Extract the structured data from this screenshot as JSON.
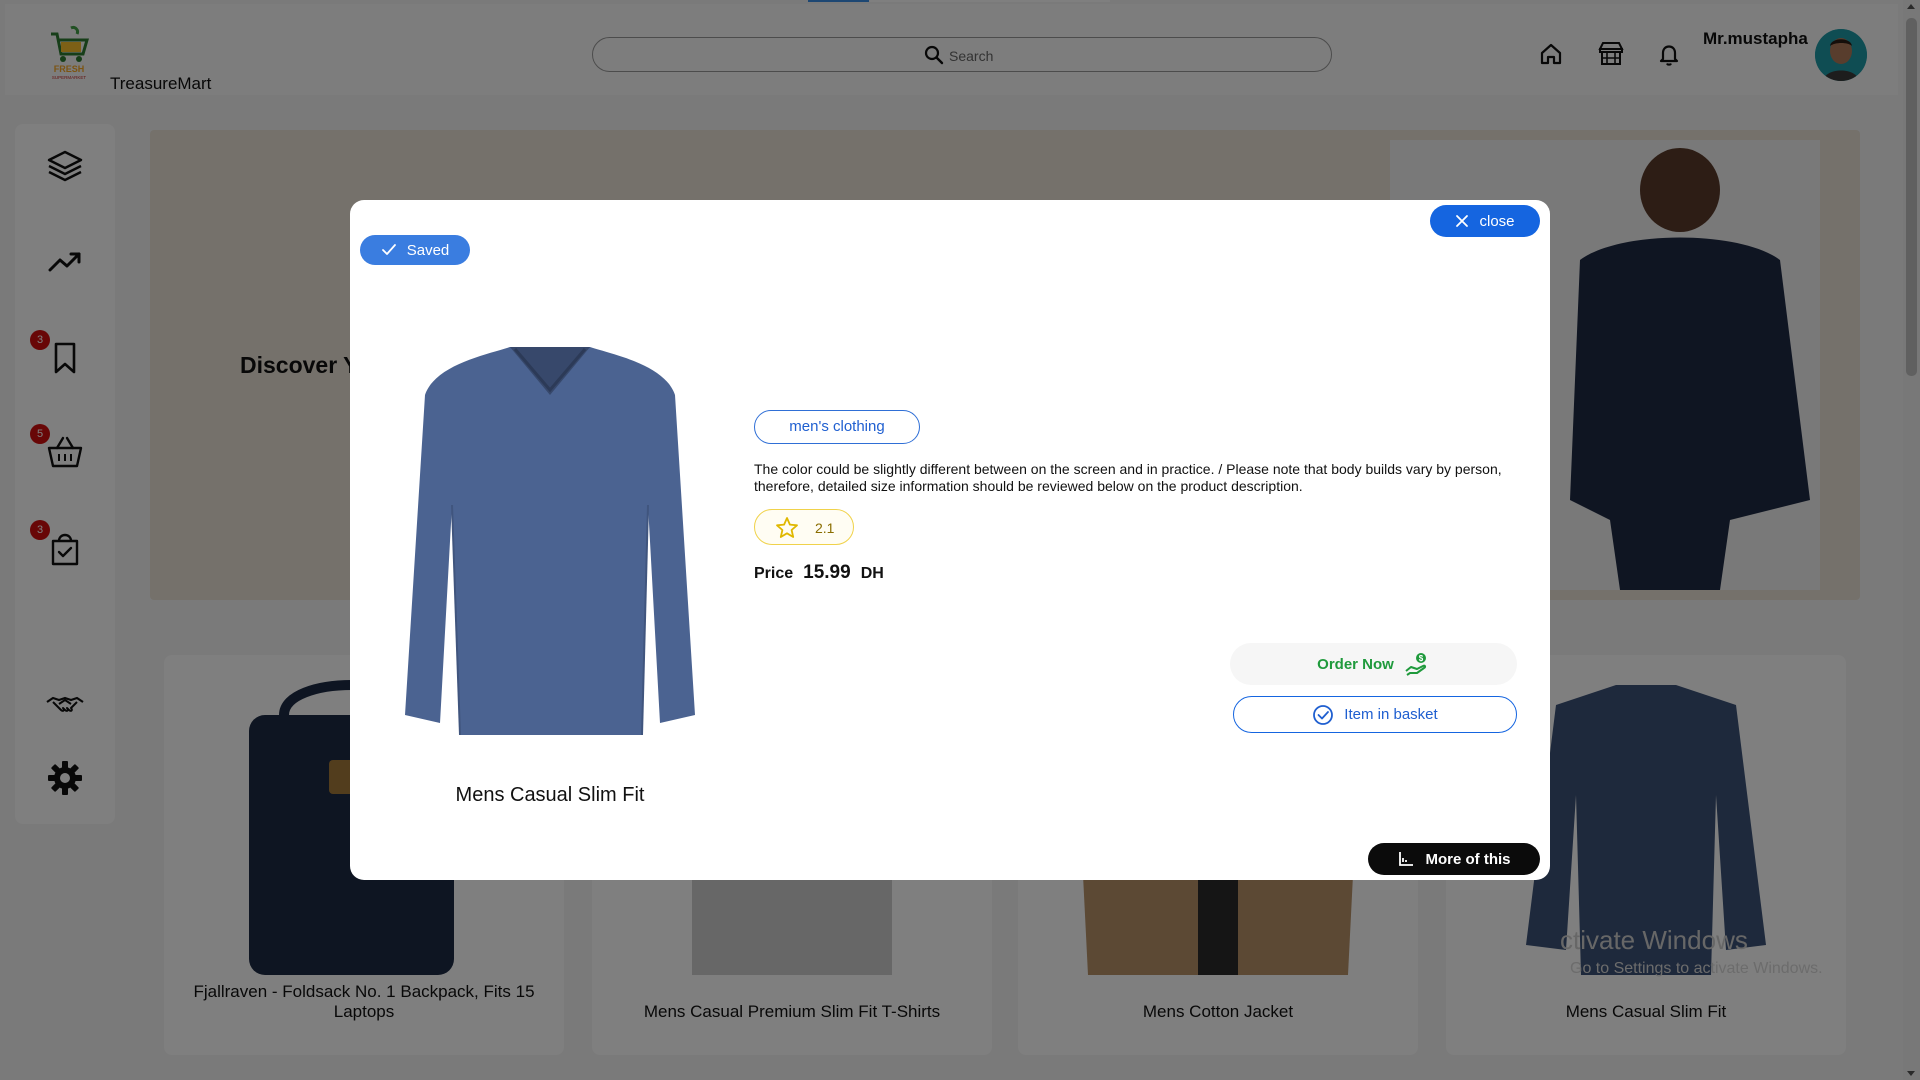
{
  "app": {
    "brand": "TreasureMart",
    "logo_text": "FRESH SUPERMARKET"
  },
  "header": {
    "search": {
      "placeholder": "Search"
    },
    "icons": [
      "home-icon",
      "store-icon",
      "bell-icon"
    ],
    "username": "Mr.mustapha"
  },
  "sidebar": {
    "items": [
      {
        "icon": "layers-icon",
        "badge": ""
      },
      {
        "icon": "trending-icon",
        "badge": ""
      },
      {
        "icon": "bookmark-icon",
        "badge": "3"
      },
      {
        "icon": "basket-icon",
        "badge": "5"
      },
      {
        "icon": "shopping-bag-icon",
        "badge": "3"
      },
      {
        "icon": "handshake-icon",
        "badge": ""
      },
      {
        "icon": "gear-icon",
        "badge": ""
      }
    ]
  },
  "hero": {
    "text": "Discover Yo"
  },
  "cards": [
    {
      "title": "Fjallraven - Foldsack No. 1 Backpack, Fits 15 Laptops"
    },
    {
      "title": "Mens Casual Premium Slim Fit T-Shirts"
    },
    {
      "title": "Mens Cotton Jacket"
    },
    {
      "title": "Mens Casual Slim Fit"
    }
  ],
  "watermark": {
    "line1": "ctivate Windows",
    "line2": "Go to Settings to activate Windows."
  },
  "modal": {
    "saved_label": "Saved",
    "close_label": "close",
    "product_name": "Mens Casual Slim Fit",
    "category": "men's clothing",
    "description": "The color could be slightly different between on the screen and in practice. / Please note that body builds vary by person, therefore, detailed size information should be reviewed below on the product description.",
    "rating": "2.1",
    "price_label": "Price",
    "price_value": "15.99",
    "currency": "DH",
    "order_label": "Order Now",
    "basket_label": "Item in basket",
    "more_label": "More of this"
  },
  "colors": {
    "primary_blue": "#1565e0",
    "saved_blue": "#3a7de0",
    "order_green": "#1f9a3c",
    "badge_red": "#d10f0f",
    "rating_yellow": "#f0d24a"
  }
}
